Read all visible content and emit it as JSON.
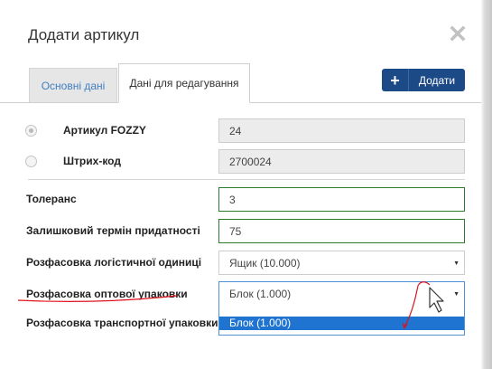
{
  "dialog": {
    "title": "Додати артикул"
  },
  "tabs": [
    {
      "label": "Основні дані"
    },
    {
      "label": "Дані для редагування"
    }
  ],
  "add_button": {
    "label": "Додати"
  },
  "identifiers": {
    "article": {
      "label": "Артикул FOZZY",
      "value": "24",
      "selected": true
    },
    "barcode": {
      "label": "Штрих-код",
      "value": "2700024",
      "selected": false
    }
  },
  "fields": {
    "tolerance": {
      "label": "Толеранс",
      "value": "3"
    },
    "shelf_life": {
      "label": "Залишковий термін придатності",
      "value": "75"
    },
    "logistic_pack": {
      "label": "Розфасовка логістичної одиниці",
      "value": "Ящик (10.000)"
    },
    "wholesale_pack": {
      "label": "Розфасовка оптової упаковки",
      "value": "Блок (1.000)",
      "options": [
        "Блок (1.000)"
      ]
    },
    "transport_pack": {
      "label": "Розфасовка транспортної упаковки"
    }
  },
  "colors": {
    "primary": "#1b4a86",
    "tab_link": "#3f7fc1",
    "valid_border": "#2d7a2d",
    "option_highlight": "#1e74d0",
    "annotation": "#e0141e"
  }
}
